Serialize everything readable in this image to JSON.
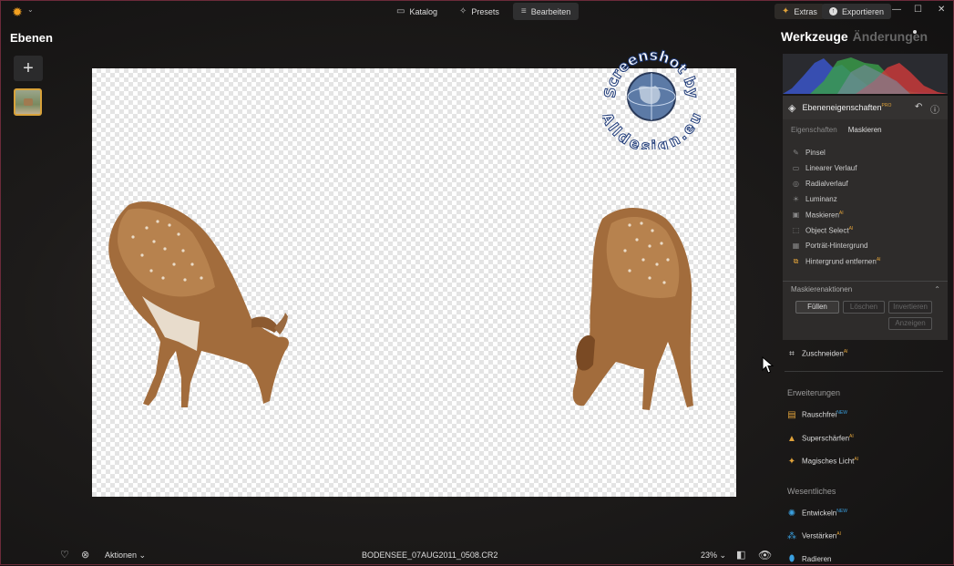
{
  "topbar": {
    "tabs": [
      {
        "label": "Katalog",
        "icon": "folder-icon"
      },
      {
        "label": "Presets",
        "icon": "sparkle-icon"
      },
      {
        "label": "Bearbeiten",
        "icon": "sliders-icon"
      }
    ],
    "extras_label": "Extras",
    "export_label": "Exportieren"
  },
  "left": {
    "title": "Ebenen"
  },
  "watermark": {
    "text_top": "Screenshot by",
    "text_bottom": "Alldesign.eu"
  },
  "bottombar": {
    "actions_label": "Aktionen",
    "filename": "BODENSEE_07AUG2011_0508.CR2",
    "zoom": "23%"
  },
  "panel": {
    "tab_tools": "Werkzeuge",
    "tab_changes": "Änderungen",
    "layer_props": {
      "title": "Ebeneneigenschaften",
      "badge": "PRO",
      "subtab_properties": "Eigenschaften",
      "subtab_mask": "Maskieren",
      "items": [
        {
          "label": "Pinsel",
          "badge": ""
        },
        {
          "label": "Linearer Verlauf",
          "badge": ""
        },
        {
          "label": "Radialverlauf",
          "badge": ""
        },
        {
          "label": "Luminanz",
          "badge": ""
        },
        {
          "label": "Maskieren",
          "badge": "AI"
        },
        {
          "label": "Object Select",
          "badge": "AI"
        },
        {
          "label": "Porträt-Hintergrund",
          "badge": ""
        },
        {
          "label": "Hintergrund entfernen",
          "badge": "AI"
        }
      ],
      "mask_actions_title": "Maskierenaktionen",
      "btn_fill": "Füllen",
      "btn_delete": "Löschen",
      "btn_invert": "Invertieren",
      "btn_show": "Anzeigen"
    },
    "crop": {
      "label": "Zuschneiden",
      "badge": "AI"
    },
    "extensions": {
      "title": "Erweiterungen",
      "items": [
        {
          "label": "Rauschfrei",
          "badge": "NEW"
        },
        {
          "label": "Superschärfen",
          "badge": "AI"
        },
        {
          "label": "Magisches Licht",
          "badge": "AI"
        }
      ]
    },
    "essentials": {
      "title": "Wesentliches",
      "items": [
        {
          "label": "Entwickeln",
          "badge": "NEW"
        },
        {
          "label": "Verstärken",
          "badge": "AI"
        },
        {
          "label": "Radieren",
          "badge": ""
        }
      ]
    }
  },
  "colors": {
    "accent": "#e0a23a",
    "new_badge": "#3aa0e0",
    "window_border": "#6b2a3a"
  }
}
